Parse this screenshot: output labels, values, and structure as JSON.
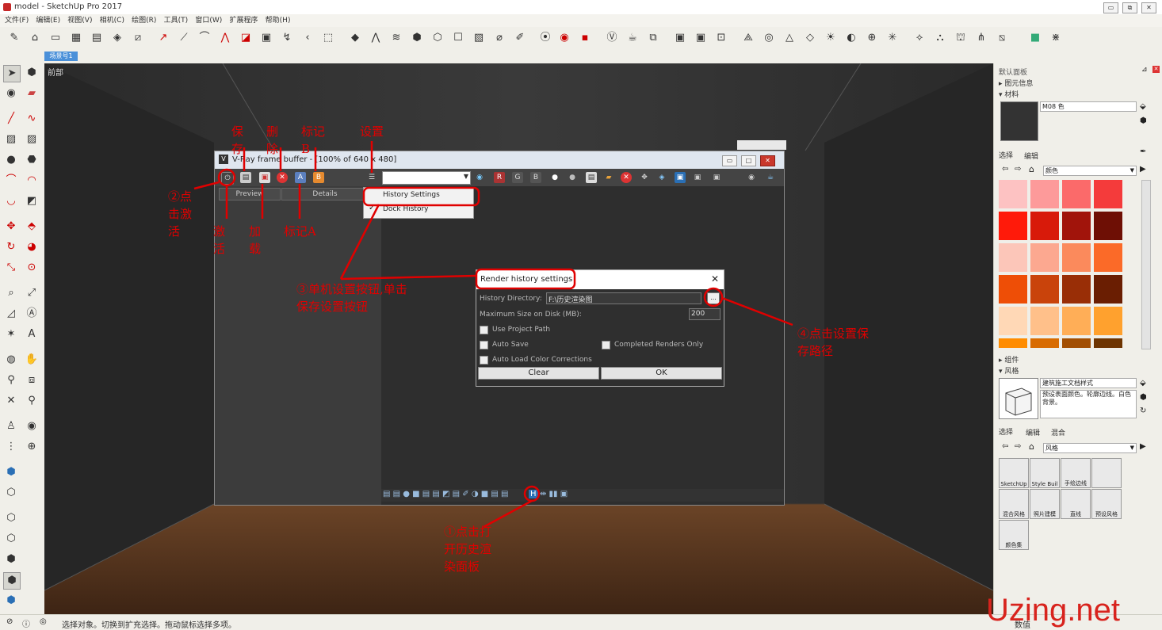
{
  "window": {
    "title": "model - SketchUp Pro 2017",
    "buttons": [
      "▭",
      "⧉",
      "✕"
    ]
  },
  "menu": [
    "文件(F)",
    "编辑(E)",
    "视图(V)",
    "相机(C)",
    "绘图(R)",
    "工具(T)",
    "窗口(W)",
    "扩展程序",
    "帮助(H)"
  ],
  "scene_tab": "场景号1",
  "viewport_label": "前部",
  "status_text": "选择对象。切换到扩充选择。拖动鼠标选择多项。",
  "status_right": "数值",
  "watermark": "Uzing.net",
  "vfb": {
    "title": "V-Ray frame buffer - [100% of 640 x 480]",
    "tabs": [
      "Preview",
      "Details"
    ],
    "channel_buttons": [
      "R",
      "G",
      "B"
    ],
    "mark_a": "A",
    "mark_b": "B"
  },
  "popup": {
    "items": [
      "History Settings",
      "Dock History"
    ],
    "check": "✓"
  },
  "dialog": {
    "title": "Render history settings",
    "close": "✕",
    "dir_label": "History Directory:",
    "dir_value": "F:\\历史渲染图",
    "browse": "...",
    "size_label": "Maximum Size on Disk (MB):",
    "size_value": "200",
    "use_project_path": "Use Project Path",
    "auto_save": "Auto Save",
    "completed_only": "Completed Renders Only",
    "auto_load": "Auto Load Color Corrections",
    "clear": "Clear",
    "ok": "OK"
  },
  "tray": {
    "title": "默认面板",
    "entity_info": "图元信息",
    "materials": "材料",
    "material_name": "M08 色",
    "select_tab": "选择",
    "edit_tab": "编辑",
    "color_category": "颜色",
    "components": "组件",
    "styles": "风格",
    "style_name": "建筑施工文档样式",
    "style_desc": "预设表面颜色。轮廓边线。白色背景。",
    "mix_tab": "混合",
    "style_category": "风格",
    "style_items": [
      "SketchUp",
      "Style Buil",
      "手绘边线",
      "",
      "混合风格",
      "照片建模",
      "直线",
      "预设风格",
      "颜色集"
    ]
  },
  "colors": {
    "swatches": [
      "#fdc2c2",
      "#fd9a9a",
      "#fb6a6a",
      "#f43b3b",
      "#ff1a0a",
      "#d81a0a",
      "#a1140b",
      "#6e0f05",
      "#fcc6b9",
      "#fca890",
      "#fb8a5c",
      "#fb6a28",
      "#ee4e06",
      "#c9430b",
      "#992e06",
      "#6a1e02",
      "#ffd8b6",
      "#ffc08a",
      "#ffae57",
      "#ffa12e",
      "#ff8c00",
      "#d86b00",
      "#a24e02",
      "#6d3401"
    ]
  },
  "annotations": {
    "save": "保存",
    "delete": "删除",
    "mark_b": "标记B",
    "settings": "设置",
    "click_activate": "②点击激活",
    "activate": "激活",
    "load": "加载",
    "mark_a": "标记A",
    "step3": "③单机设置按钮,单击保存设置按钮",
    "step4": "④点击设置保存路径",
    "step1": "①点击打开历史渲染面板"
  }
}
